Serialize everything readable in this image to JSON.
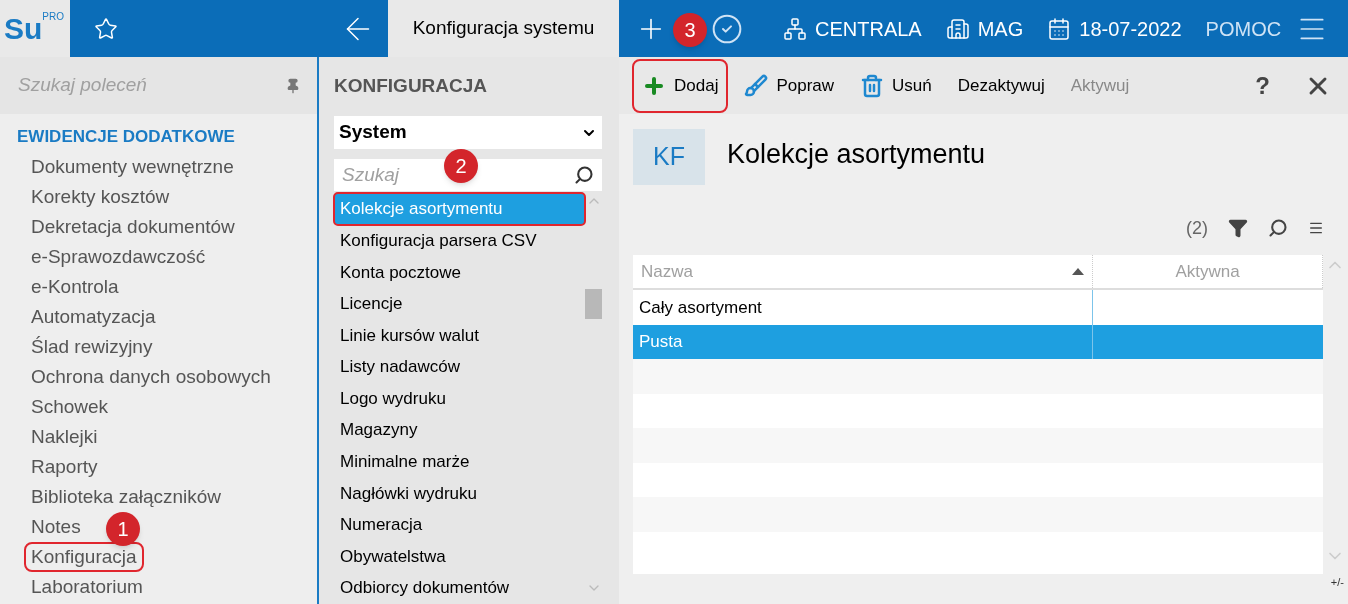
{
  "topbar": {
    "logo": "Su",
    "logo_badge": "PRO",
    "tab_title": "Konfiguracja systemu",
    "plus_callout": "3",
    "context": [
      {
        "kind": "network",
        "label": "CENTRALA"
      },
      {
        "kind": "building",
        "label": "MAG"
      },
      {
        "kind": "calendar",
        "label": "18-07-2022"
      },
      {
        "kind": "plain",
        "label": "POMOC"
      }
    ]
  },
  "sidebar": {
    "search_placeholder": "Szukaj poleceń",
    "section": "EWIDENCJE DODATKOWE",
    "callout": "1",
    "items": [
      {
        "label": "Dokumenty wewnętrzne",
        "highlighted": false
      },
      {
        "label": "Korekty kosztów",
        "highlighted": false
      },
      {
        "label": "Dekretacja dokumentów",
        "highlighted": false
      },
      {
        "label": "e-Sprawozdawczość",
        "highlighted": false
      },
      {
        "label": "e-Kontrola",
        "highlighted": false
      },
      {
        "label": "Automatyzacja",
        "highlighted": false
      },
      {
        "label": "Ślad rewizyjny",
        "highlighted": false
      },
      {
        "label": "Ochrona danych osobowych",
        "highlighted": false
      },
      {
        "label": "Schowek",
        "highlighted": false
      },
      {
        "label": "Naklejki",
        "highlighted": false
      },
      {
        "label": "Raporty",
        "highlighted": false
      },
      {
        "label": "Biblioteka załączników",
        "highlighted": false
      },
      {
        "label": "Notes",
        "highlighted": false
      },
      {
        "label": "Konfiguracja",
        "highlighted": true
      },
      {
        "label": "Laboratorium",
        "highlighted": false
      }
    ]
  },
  "config_panel": {
    "title": "KONFIGURACJA",
    "select_value": "System",
    "search_placeholder": "Szukaj",
    "callout": "2",
    "items": [
      {
        "label": "Kolekcje asortymentu",
        "selected": true,
        "highlighted": true
      },
      {
        "label": "Konfiguracja parsera CSV",
        "selected": false,
        "highlighted": false
      },
      {
        "label": "Konta pocztowe",
        "selected": false,
        "highlighted": false
      },
      {
        "label": "Licencje",
        "selected": false,
        "highlighted": false
      },
      {
        "label": "Linie kursów walut",
        "selected": false,
        "highlighted": false
      },
      {
        "label": "Listy nadawców",
        "selected": false,
        "highlighted": false
      },
      {
        "label": "Logo wydruku",
        "selected": false,
        "highlighted": false
      },
      {
        "label": "Magazyny",
        "selected": false,
        "highlighted": false
      },
      {
        "label": "Minimalne marże",
        "selected": false,
        "highlighted": false
      },
      {
        "label": "Nagłówki wydruku",
        "selected": false,
        "highlighted": false
      },
      {
        "label": "Numeracja",
        "selected": false,
        "highlighted": false
      },
      {
        "label": "Obywatelstwa",
        "selected": false,
        "highlighted": false
      },
      {
        "label": "Odbiorcy dokumentów",
        "selected": false,
        "highlighted": false
      }
    ]
  },
  "toolbar": {
    "buttons": [
      {
        "kind": "add",
        "label": "Dodaj",
        "disabled": false,
        "highlighted": true
      },
      {
        "kind": "edit",
        "label": "Popraw",
        "disabled": false,
        "highlighted": false
      },
      {
        "kind": "delete",
        "label": "Usuń",
        "disabled": false,
        "highlighted": false
      },
      {
        "kind": "text",
        "label": "Dezaktywuj",
        "disabled": false,
        "highlighted": false
      },
      {
        "kind": "text",
        "label": "Aktywuj",
        "disabled": true,
        "highlighted": false
      }
    ],
    "help": "?"
  },
  "content": {
    "badge": "KF",
    "title": "Kolekcje asortymentu",
    "count": "(2)",
    "table": {
      "columns": [
        {
          "label": "Nazwa",
          "sorted": true
        },
        {
          "label": "Aktywna",
          "sorted": false
        }
      ],
      "rows": [
        {
          "cells": [
            "Cały asortyment",
            ""
          ],
          "selected": false
        },
        {
          "cells": [
            "Pusta",
            ""
          ],
          "selected": true
        }
      ]
    },
    "footer": "+/-"
  }
}
